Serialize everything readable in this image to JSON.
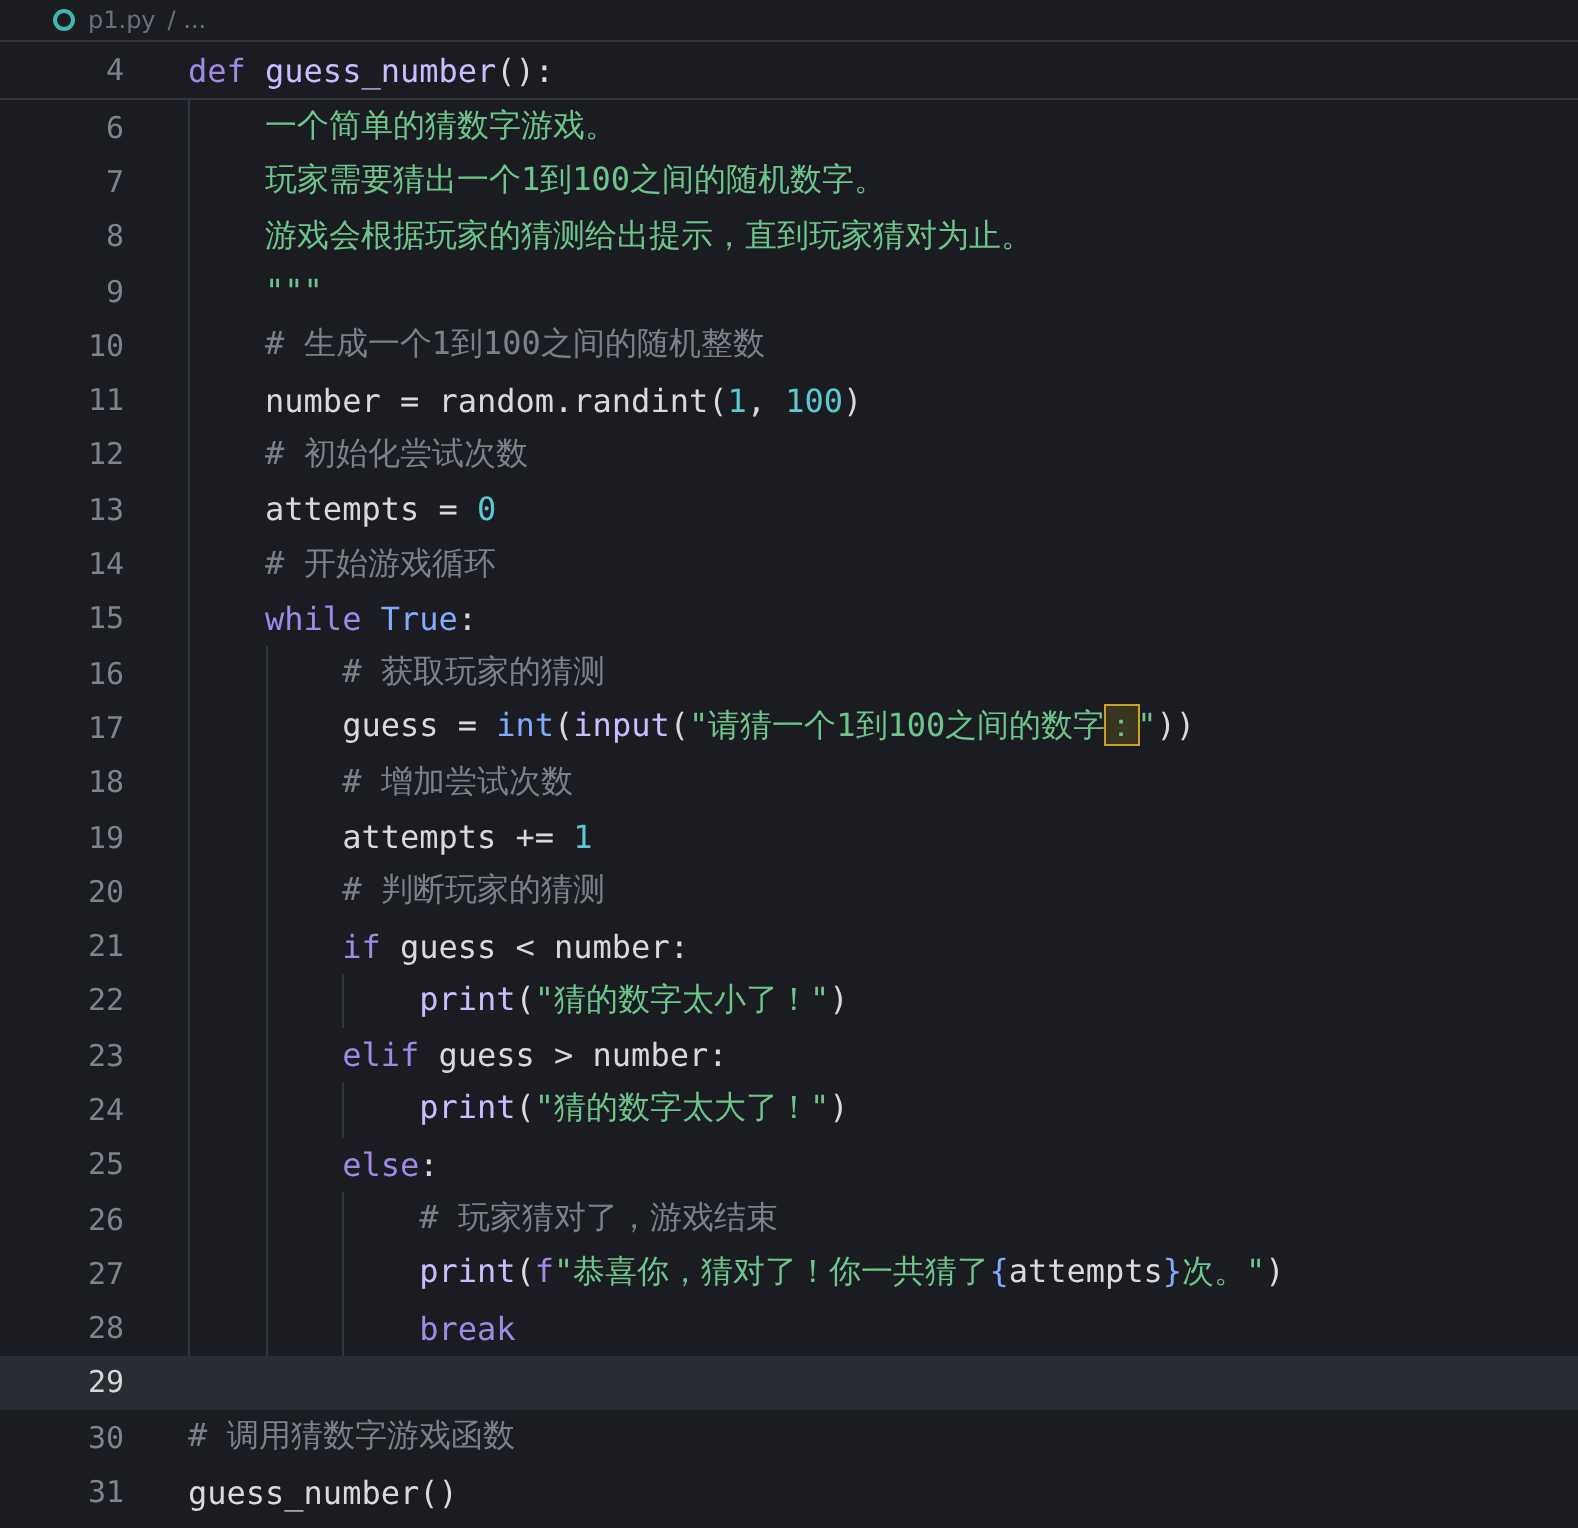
{
  "breadcrumb": {
    "file": "p1.py",
    "rest": "/ ..."
  },
  "sticky_line": {
    "number": "4",
    "tokens": [
      {
        "kind": "kw",
        "t": "def "
      },
      {
        "kind": "fn",
        "t": "guess_number"
      },
      {
        "kind": "p",
        "t": "():"
      }
    ]
  },
  "lines": [
    {
      "number": "6",
      "current": false,
      "tokens": [
        {
          "kind": "str",
          "t": "    一个简单的猜数字游戏。"
        }
      ]
    },
    {
      "number": "7",
      "current": false,
      "tokens": [
        {
          "kind": "str",
          "t": "    玩家需要猜出一个1到100之间的随机数字。"
        }
      ]
    },
    {
      "number": "8",
      "current": false,
      "tokens": [
        {
          "kind": "str",
          "t": "    游戏会根据玩家的猜测给出提示，直到玩家猜对为止。"
        }
      ]
    },
    {
      "number": "9",
      "current": false,
      "tokens": [
        {
          "kind": "str",
          "t": "    \"\"\""
        }
      ]
    },
    {
      "number": "10",
      "current": false,
      "tokens": [
        {
          "kind": "cmt",
          "t": "    # 生成一个1到100之间的随机整数"
        }
      ]
    },
    {
      "number": "11",
      "current": false,
      "tokens": [
        {
          "kind": "p",
          "t": "    number = random.randint("
        },
        {
          "kind": "num",
          "t": "1"
        },
        {
          "kind": "p",
          "t": ", "
        },
        {
          "kind": "num",
          "t": "100"
        },
        {
          "kind": "p",
          "t": ")"
        }
      ]
    },
    {
      "number": "12",
      "current": false,
      "tokens": [
        {
          "kind": "cmt",
          "t": "    # 初始化尝试次数"
        }
      ]
    },
    {
      "number": "13",
      "current": false,
      "tokens": [
        {
          "kind": "p",
          "t": "    attempts = "
        },
        {
          "kind": "num",
          "t": "0"
        }
      ]
    },
    {
      "number": "14",
      "current": false,
      "tokens": [
        {
          "kind": "cmt",
          "t": "    # 开始游戏循环"
        }
      ]
    },
    {
      "number": "15",
      "current": false,
      "tokens": [
        {
          "kind": "kw",
          "t": "    while "
        },
        {
          "kind": "const",
          "t": "True"
        },
        {
          "kind": "p",
          "t": ":"
        }
      ]
    },
    {
      "number": "16",
      "current": false,
      "tokens": [
        {
          "kind": "cmt",
          "t": "        # 获取玩家的猜测"
        }
      ]
    },
    {
      "number": "17",
      "current": false,
      "tokens": [
        {
          "kind": "p",
          "t": "        guess = "
        },
        {
          "kind": "builtin",
          "t": "int"
        },
        {
          "kind": "p",
          "t": "("
        },
        {
          "kind": "fn",
          "t": "input"
        },
        {
          "kind": "p",
          "t": "("
        },
        {
          "kind": "str",
          "t": "\"请猜一个1到100之间的数字"
        },
        {
          "kind": "match",
          "t": "："
        },
        {
          "kind": "str",
          "t": "\""
        },
        {
          "kind": "p",
          "t": "))"
        }
      ]
    },
    {
      "number": "18",
      "current": false,
      "tokens": [
        {
          "kind": "cmt",
          "t": "        # 增加尝试次数"
        }
      ]
    },
    {
      "number": "19",
      "current": false,
      "tokens": [
        {
          "kind": "p",
          "t": "        attempts += "
        },
        {
          "kind": "num",
          "t": "1"
        }
      ]
    },
    {
      "number": "20",
      "current": false,
      "tokens": [
        {
          "kind": "cmt",
          "t": "        # 判断玩家的猜测"
        }
      ]
    },
    {
      "number": "21",
      "current": false,
      "tokens": [
        {
          "kind": "kw",
          "t": "        if"
        },
        {
          "kind": "p",
          "t": " guess < number:"
        }
      ]
    },
    {
      "number": "22",
      "current": false,
      "tokens": [
        {
          "kind": "fn",
          "t": "            print"
        },
        {
          "kind": "p",
          "t": "("
        },
        {
          "kind": "str",
          "t": "\"猜的数字太小了！\""
        },
        {
          "kind": "p",
          "t": ")"
        }
      ]
    },
    {
      "number": "23",
      "current": false,
      "tokens": [
        {
          "kind": "kw",
          "t": "        elif"
        },
        {
          "kind": "p",
          "t": " guess > number:"
        }
      ]
    },
    {
      "number": "24",
      "current": false,
      "tokens": [
        {
          "kind": "fn",
          "t": "            print"
        },
        {
          "kind": "p",
          "t": "("
        },
        {
          "kind": "str",
          "t": "\"猜的数字太大了！\""
        },
        {
          "kind": "p",
          "t": ")"
        }
      ]
    },
    {
      "number": "25",
      "current": false,
      "tokens": [
        {
          "kind": "kw",
          "t": "        else"
        },
        {
          "kind": "p",
          "t": ":"
        }
      ]
    },
    {
      "number": "26",
      "current": false,
      "tokens": [
        {
          "kind": "cmt",
          "t": "            # 玩家猜对了，游戏结束"
        }
      ]
    },
    {
      "number": "27",
      "current": false,
      "tokens": [
        {
          "kind": "fn",
          "t": "            print"
        },
        {
          "kind": "p",
          "t": "("
        },
        {
          "kind": "kw",
          "t": "f"
        },
        {
          "kind": "str",
          "t": "\"恭喜你，猜对了！你一共猜了"
        },
        {
          "kind": "brace",
          "t": "{"
        },
        {
          "kind": "p",
          "t": "attempts"
        },
        {
          "kind": "brace",
          "t": "}"
        },
        {
          "kind": "str",
          "t": "次。\""
        },
        {
          "kind": "p",
          "t": ")"
        }
      ]
    },
    {
      "number": "28",
      "current": false,
      "tokens": [
        {
          "kind": "kw",
          "t": "            break"
        }
      ]
    },
    {
      "number": "29",
      "current": true
    },
    {
      "number": "30",
      "current": false,
      "tokens": [
        {
          "kind": "cmt",
          "t": "# 调用猜数字游戏函数"
        }
      ]
    },
    {
      "number": "31",
      "current": false,
      "tokens": [
        {
          "kind": "p",
          "t": "guess_number()"
        }
      ]
    }
  ]
}
